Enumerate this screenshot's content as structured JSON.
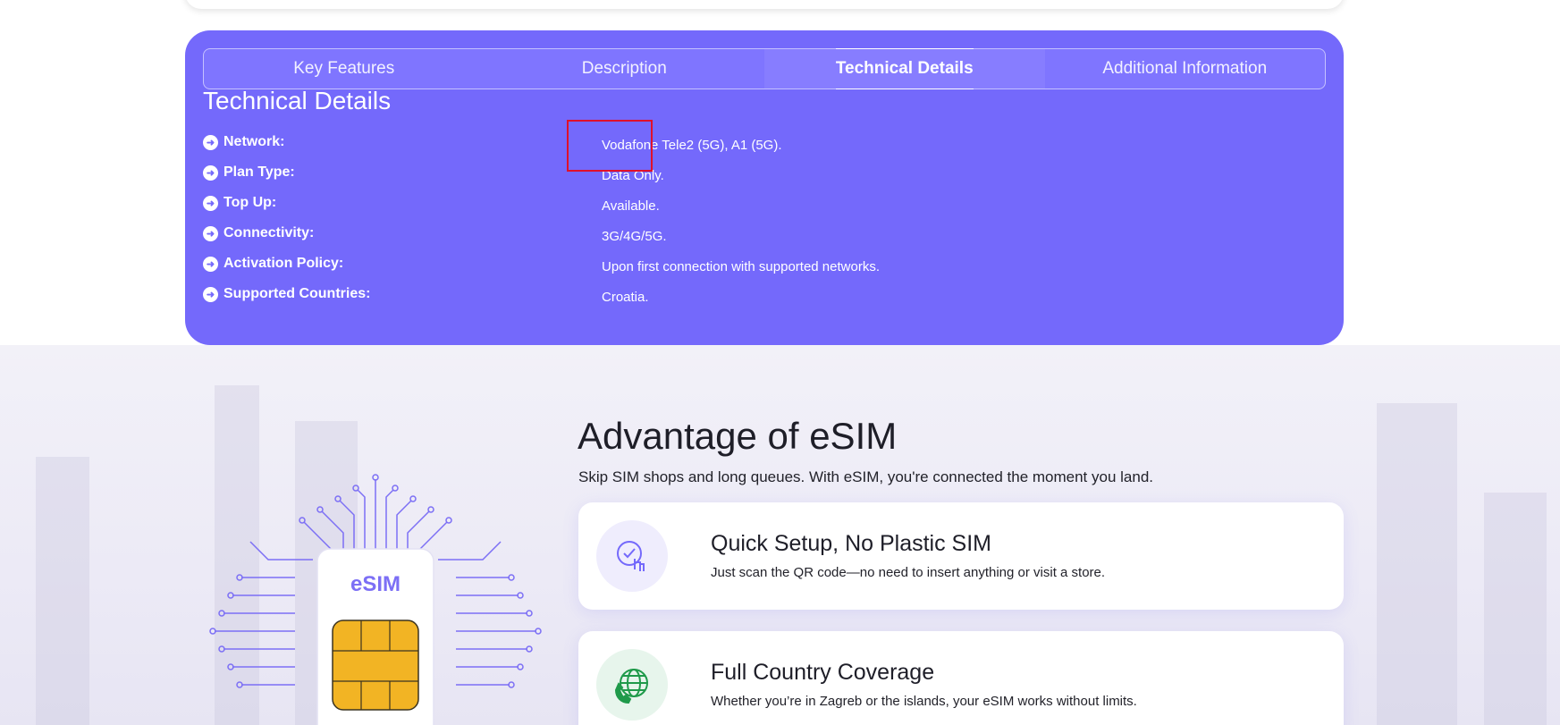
{
  "tabs": [
    {
      "label": "Key Features"
    },
    {
      "label": "Description"
    },
    {
      "label": "Technical Details"
    },
    {
      "label": "Additional Information"
    }
  ],
  "technical": {
    "title": "Technical Details",
    "rows": [
      {
        "label": "Network:",
        "value": "Vodafone Tele2 (5G), A1 (5G)."
      },
      {
        "label": "Plan Type:",
        "value": "Data Only."
      },
      {
        "label": "Top Up:",
        "value": "Available."
      },
      {
        "label": "Connectivity:",
        "value": "3G/4G/5G."
      },
      {
        "label": "Activation Policy:",
        "value": "Upon first connection with supported networks."
      },
      {
        "label": "Supported Countries:",
        "value": "Croatia."
      }
    ]
  },
  "advantage": {
    "title": "Advantage of eSIM",
    "subtitle": "Skip SIM shops and long queues. With eSIM, you're connected the moment you land.",
    "esim_label": "eSIM",
    "cards": [
      {
        "title": "Quick Setup, No Plastic SIM",
        "desc": "Just scan the QR code—no need to insert anything or visit a store.",
        "icon": "tap-check-icon"
      },
      {
        "title": "Full Country Coverage",
        "desc": "Whether you’re in Zagreb or the islands, your eSIM works without limits.",
        "icon": "globe-phone-icon"
      }
    ]
  },
  "colors": {
    "accent": "#7469fb",
    "highlight": "#e0102a",
    "chip": "#f2b424",
    "green": "#1f9a4a"
  }
}
